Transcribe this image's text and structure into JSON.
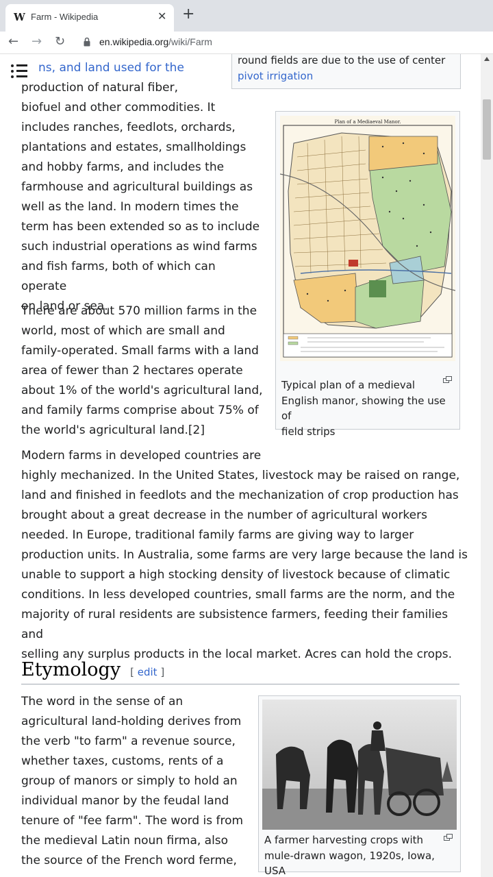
{
  "browser": {
    "tab_favicon": "W",
    "tab_title": "Farm - Wikipedia",
    "close_glyph": "✕",
    "newtab_glyph": "+",
    "url_host": "en.wikipedia.org",
    "url_path": "/wiki/Farm",
    "back_glyph": "←",
    "forward_glyph": "→",
    "reload_glyph": "↻"
  },
  "article": {
    "intro_lines": [
      "ns, and land used for the",
      "production of natural fiber,",
      "biofuel and other commodities. It",
      "includes ranches, feedlots, orchards,",
      "plantations and estates, smallholdings",
      "and hobby farms, and includes the",
      "farmhouse and agricultural buildings as",
      "well as the land. In modern times the",
      "term has been extended so as to include",
      "such industrial operations as wind farms",
      "and fish farms, both of which can operate",
      "on land or sea."
    ],
    "para2_lines": [
      "There are about 570 million farms in the",
      "world, most of which are small and",
      "family-operated. Small farms with a land",
      "area of fewer than 2 hectares operate",
      "about 1% of the world's agricultural land,",
      "and family farms comprise about 75% of",
      "the world's agricultural land.[2]"
    ],
    "para3_lines": [
      "Modern farms in developed countries are",
      "highly mechanized. In the United States, livestock may be raised on range,",
      "land and finished in feedlots and the mechanization of crop production has",
      "brought about a great decrease in the number of agricultural workers",
      "needed. In Europe, traditional family farms are giving way to larger",
      "production units. In Australia, some farms are very large because the land is",
      "unable to support a high stocking density of livestock because of climatic",
      "conditions. In less developed countries, small farms are the norm, and the",
      "majority of rural residents are subsistence farmers, feeding their families and",
      "selling any surplus products in the local market. Acres can hold the crops."
    ],
    "top_caption_line1": "round fields are due to the use of center",
    "top_caption_line2": "pivot irrigation",
    "manor_title": "Plan of a Mediaeval Manor.",
    "manor_caption_lines": [
      "Typical plan of a medieval",
      "English manor, showing the use of",
      "field strips"
    ],
    "etymology_heading": "Etymology",
    "edit_label": "edit",
    "etym_lines": [
      "The word in the sense of an",
      "agricultural land-holding derives from",
      "the verb \"to farm\" a revenue source,",
      "whether taxes, customs, rents of a",
      "group of manors or simply to hold an",
      "individual manor by the feudal land",
      "tenure of \"fee farm\". The word is from",
      "the medieval Latin noun firma, also",
      "the source of the French word ferme,"
    ],
    "wagon_caption_lines": [
      "A farmer harvesting crops with",
      "mule-drawn wagon, 1920s, Iowa, USA"
    ]
  },
  "colors": {
    "link": "#3366cc",
    "text": "#202122"
  }
}
